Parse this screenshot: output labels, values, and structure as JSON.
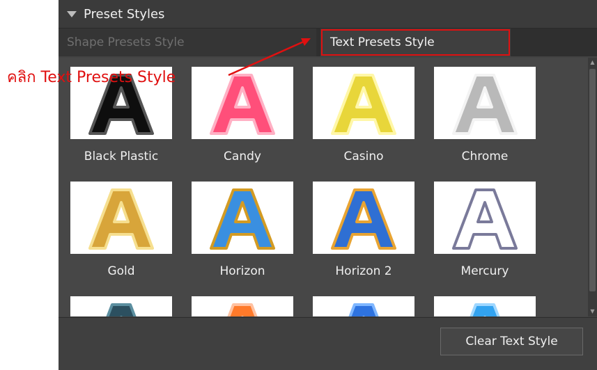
{
  "panel": {
    "title": "Preset Styles",
    "tabs": [
      {
        "label": "Shape Presets Style"
      },
      {
        "label": "Text Presets Style"
      }
    ]
  },
  "presets": [
    {
      "label": "Black Plastic",
      "fill": "#0e0e0e",
      "edge": "#555555"
    },
    {
      "label": "Candy",
      "fill": "#ff4f7a",
      "edge": "#ffb0c4"
    },
    {
      "label": "Casino",
      "fill": "#e8d63a",
      "edge": "#fff7a8"
    },
    {
      "label": "Chrome",
      "fill": "#b9b9b9",
      "edge": "#f3f3f3"
    },
    {
      "label": "Gold",
      "fill": "#d8a53a",
      "edge": "#f6df8f"
    },
    {
      "label": "Horizon",
      "fill": "#3a8fe0",
      "edge": "#d39b23"
    },
    {
      "label": "Horizon 2",
      "fill": "#2f6fd3",
      "edge": "#e8a433"
    },
    {
      "label": "Mercury",
      "fill": "#ffffff",
      "edge": "#7a7a9a"
    },
    {
      "label": "",
      "fill": "#2c5060",
      "edge": "#5c8fa0"
    },
    {
      "label": "",
      "fill": "#ff7a2a",
      "edge": "#ffc1a0"
    },
    {
      "label": "",
      "fill": "#2e73e0",
      "edge": "#7eb6ff"
    },
    {
      "label": "",
      "fill": "#32a3f0",
      "edge": "#9fd7ff"
    }
  ],
  "footer": {
    "clear_label": "Clear Text Style"
  },
  "annotation": {
    "text": "คลิก Text Presets Style",
    "color": "#e01010"
  }
}
